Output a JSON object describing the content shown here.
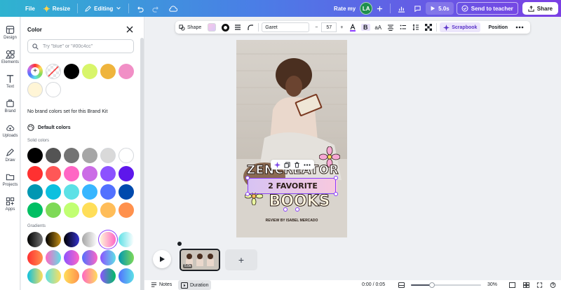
{
  "topbar": {
    "file": "File",
    "resize": "Resize",
    "editing": "Editing",
    "rate": "Rate my",
    "avatar": "LA",
    "play_time": "5.0s",
    "send": "Send to teacher",
    "share": "Share"
  },
  "rail": {
    "items": [
      "Design",
      "Elements",
      "Text",
      "Brand",
      "Uploads",
      "Draw",
      "Projects",
      "Apps"
    ]
  },
  "color_panel": {
    "title": "Color",
    "search_placeholder": "Try \"blue\" or \"#00c4cc\"",
    "doc_colors": [
      "#000000",
      "#d8f56a",
      "#efb43c",
      "#f18fc6",
      "#fff5d6",
      "#ffffff"
    ],
    "brand_msg": "No brand colors set for this Brand Kit",
    "default_colors": "Default colors",
    "solid_label": "Solid colors",
    "solid": [
      "#000000",
      "#545454",
      "#737373",
      "#a6a6a6",
      "#d9d9d9",
      "#ffffff",
      "#ff3131",
      "#ff5757",
      "#ff66c4",
      "#cb6ce6",
      "#8c52ff",
      "#5e17eb",
      "#0097b2",
      "#0cc0df",
      "#5ce1e6",
      "#38b6ff",
      "#5271ff",
      "#004aad",
      "#00bf63",
      "#7ed957",
      "#c1ff72",
      "#ffde59",
      "#ffbd59",
      "#ff914d"
    ],
    "gradients_label": "Gradients",
    "gradients": [
      [
        "#000000",
        "#737373"
      ],
      [
        "#000000",
        "#c89116"
      ],
      [
        "#000000",
        "#3533cd"
      ],
      [
        "#a6a6a6",
        "#ffffff"
      ],
      [
        "#fff5d6",
        "#ff66c4"
      ],
      [
        "#5de0e6",
        "#ffffff"
      ],
      [
        "#ff3131",
        "#ff914d"
      ],
      [
        "#ff66c4",
        "#5ce1e6"
      ],
      [
        "#8c52ff",
        "#ff66c4"
      ],
      [
        "#5170ff",
        "#ff66c4"
      ],
      [
        "#8c52ff",
        "#5ce1e6"
      ],
      [
        "#0097b2",
        "#7ed957"
      ],
      [
        "#0cc0df",
        "#ffde59"
      ],
      [
        "#5ce1e6",
        "#ffde59"
      ],
      [
        "#ffde59",
        "#ff914d"
      ],
      [
        "#ff66c4",
        "#ffde59"
      ],
      [
        "#8c52ff",
        "#00bf63"
      ],
      [
        "#5170ff",
        "#5ce1e6"
      ]
    ]
  },
  "element_toolbar": {
    "shape": "Shape",
    "font": "Garet",
    "minus": "−",
    "size": "57",
    "plus": "+",
    "bold": "B",
    "scrapbook": "Scrapbook",
    "position": "Position"
  },
  "canvas": {
    "title_line1": "ZENCREATOR",
    "title_line2": "2 FAVORITE",
    "title_line3": "BOOKS",
    "review": "REVIEW BY ISABEL MERCADO"
  },
  "timeline": {
    "thumb_duration": "5.0s",
    "add": "+"
  },
  "bottombar": {
    "notes": "Notes",
    "duration": "Duration",
    "time": "0:00 / 0:05",
    "zoom": "30%",
    "zoom_level": 0.3
  }
}
